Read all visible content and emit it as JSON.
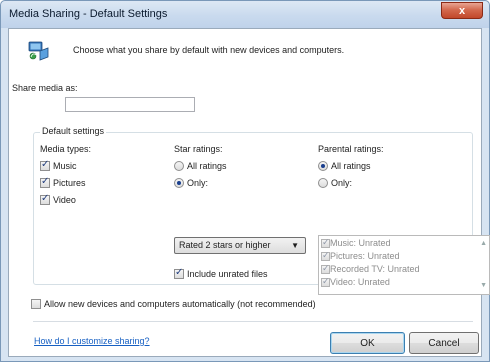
{
  "window": {
    "title": "Media Sharing - Default Settings",
    "close_glyph": "x"
  },
  "header": {
    "icon": "media-sharing-network-icon",
    "text": "Choose what you share by default with new devices and computers."
  },
  "share": {
    "label": "Share media as:",
    "value": ""
  },
  "group": {
    "legend": "Default settings"
  },
  "media_types": {
    "title": "Media types:",
    "items": [
      {
        "label": "Music",
        "checked": true
      },
      {
        "label": "Pictures",
        "checked": true
      },
      {
        "label": "Video",
        "checked": true
      }
    ]
  },
  "star_ratings": {
    "title": "Star ratings:",
    "options": [
      {
        "label": "All ratings",
        "selected": false
      },
      {
        "label": "Only:",
        "selected": true
      }
    ],
    "dropdown_value": "Rated 2 stars or higher",
    "include_unrated": {
      "label": "Include unrated files",
      "checked": true
    }
  },
  "parental_ratings": {
    "title": "Parental ratings:",
    "options": [
      {
        "label": "All ratings",
        "selected": true
      },
      {
        "label": "Only:",
        "selected": false
      }
    ],
    "list": [
      {
        "label": "Music: Unrated",
        "checked": true
      },
      {
        "label": "Pictures: Unrated",
        "checked": true
      },
      {
        "label": "Recorded TV: Unrated",
        "checked": true
      },
      {
        "label": "Video: Unrated",
        "checked": true
      }
    ]
  },
  "allow": {
    "label": "Allow new devices and computers automatically (not recommended)",
    "checked": false
  },
  "footer": {
    "link": "How do I customize sharing?",
    "ok": "OK",
    "cancel": "Cancel"
  },
  "colors": {
    "link": "#1760c3",
    "title_bar": "#c9daee",
    "close": "#c2482b"
  }
}
